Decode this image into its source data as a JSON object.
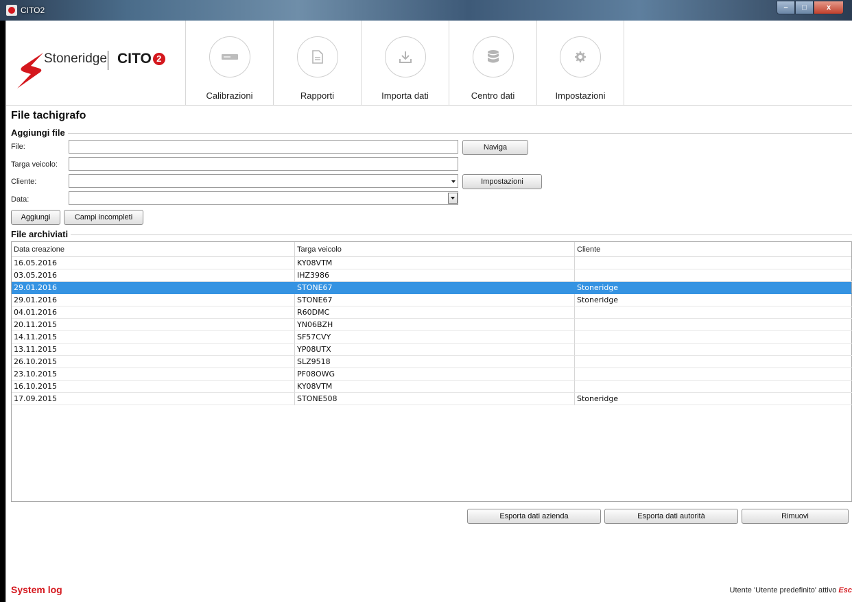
{
  "window": {
    "title": "CITO2",
    "controls": [
      "–",
      "□",
      "x"
    ]
  },
  "logo": {
    "brand": "Stoneridge",
    "product": "CITO",
    "product_suffix": "2"
  },
  "toolbar": {
    "items": [
      {
        "label": "Calibrazioni",
        "icon": "calibration-icon"
      },
      {
        "label": "Rapporti",
        "icon": "document-icon"
      },
      {
        "label": "Importa dati",
        "icon": "download-icon"
      },
      {
        "label": "Centro dati",
        "icon": "database-icon"
      },
      {
        "label": "Impostazioni",
        "icon": "gear-icon"
      }
    ]
  },
  "page": {
    "title": "File tachigrafo"
  },
  "add_file": {
    "section_title": "Aggiungi file",
    "file_label": "File:",
    "file_value": "",
    "plate_label": "Targa veicolo:",
    "plate_value": "",
    "client_label": "Cliente:",
    "client_value": "",
    "date_label": "Data:",
    "date_value": "",
    "browse_button": "Naviga",
    "settings_button": "Impostazioni",
    "add_button": "Aggiungi",
    "incomplete_button": "Campi incompleti"
  },
  "archive": {
    "section_title": "File archiviati",
    "columns": [
      "Data creazione",
      "Targa veicolo",
      "Cliente"
    ],
    "rows": [
      {
        "date": "16.05.2016",
        "plate": "KY08VTM",
        "client": ""
      },
      {
        "date": "03.05.2016",
        "plate": "IHZ3986",
        "client": ""
      },
      {
        "date": "29.01.2016",
        "plate": "STONE67",
        "client": "Stoneridge",
        "selected": true
      },
      {
        "date": "29.01.2016",
        "plate": "STONE67",
        "client": "Stoneridge"
      },
      {
        "date": "04.01.2016",
        "plate": "R60DMC",
        "client": ""
      },
      {
        "date": "20.11.2015",
        "plate": "YN06BZH",
        "client": ""
      },
      {
        "date": "14.11.2015",
        "plate": "SF57CVY",
        "client": ""
      },
      {
        "date": "13.11.2015",
        "plate": "YP08UTX",
        "client": ""
      },
      {
        "date": "26.10.2015",
        "plate": "SLZ9518",
        "client": ""
      },
      {
        "date": "23.10.2015",
        "plate": "PF08OWG",
        "client": ""
      },
      {
        "date": "16.10.2015",
        "plate": "KY08VTM",
        "client": ""
      },
      {
        "date": "17.09.2015",
        "plate": "STONE508",
        "client": "Stoneridge"
      }
    ],
    "export_company_button": "Esporta dati azienda",
    "export_authority_button": "Esporta dati autorità",
    "remove_button": "Rimuovi"
  },
  "footer": {
    "system_log": "System log",
    "status_text": "Utente 'Utente predefinito' attivo",
    "status_action": "Esc"
  },
  "colors": {
    "accent": "#d4171d",
    "selection": "#3593e2"
  }
}
